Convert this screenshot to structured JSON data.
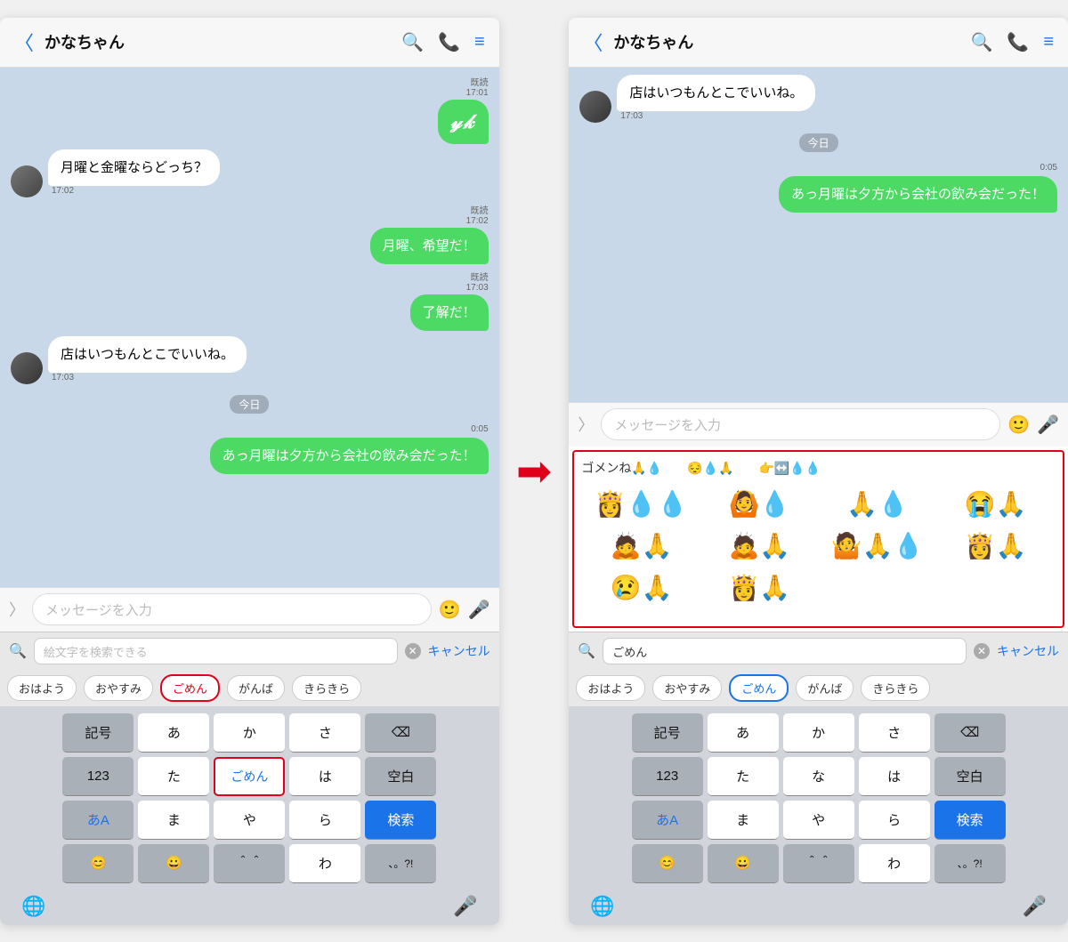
{
  "left_phone": {
    "header": {
      "back_label": "＜",
      "title": "かなちゃん",
      "search_icon": "🔍",
      "phone_icon": "📞",
      "menu_icon": "≡"
    },
    "messages": [
      {
        "id": 1,
        "side": "right",
        "text": "",
        "time": "17:01",
        "read": "既読",
        "is_handwriting": true
      },
      {
        "id": 2,
        "side": "left",
        "text": "月曜と金曜ならどっち？",
        "time": "17:02"
      },
      {
        "id": 3,
        "side": "right",
        "text": "月曜、希望だ！",
        "time": "17:02",
        "read": "既読"
      },
      {
        "id": 4,
        "side": "right",
        "text": "了解だ！",
        "time": "17:03",
        "read": "既読"
      },
      {
        "id": 5,
        "side": "left",
        "avatar": true,
        "text": "店はいつもんとこでいいね。",
        "time": "17:03"
      },
      {
        "id": 6,
        "date": "今日"
      },
      {
        "id": 7,
        "side": "right",
        "text": "あっ月曜は夕方から会社の飲み会だった！",
        "time": "0:05"
      }
    ],
    "input_placeholder": "メッセージを入力",
    "search_area": {
      "placeholder": "絵文字を検索できる",
      "cancel_label": "キャンセル"
    },
    "emoji_cats": [
      "おはよう",
      "おやすみ",
      "ごめん",
      "がんば",
      "きらきら"
    ],
    "active_cat": "ごめん",
    "keyboard": {
      "row1": [
        "記号",
        "あ",
        "か",
        "さ",
        "⌫"
      ],
      "row2": [
        "123",
        "た",
        "ごめん",
        "は",
        "空白"
      ],
      "row3": [
        "あA",
        "ま",
        "や",
        "ら",
        "検索"
      ],
      "row4": [
        "🌐",
        "😊",
        "＾＾",
        "わ",
        "、。?!"
      ],
      "bottom": [
        "🌐",
        "🎤"
      ]
    },
    "highlight_key": "ごめん",
    "highlight_cat": "ごめん"
  },
  "right_phone": {
    "header": {
      "back_label": "＜",
      "title": "かなちゃん",
      "search_icon": "🔍",
      "phone_icon": "📞",
      "menu_icon": "≡"
    },
    "messages": [
      {
        "id": 1,
        "side": "left",
        "avatar": true,
        "text": "店はいつもんとこでいいね。",
        "time": "17:03"
      },
      {
        "id": 2,
        "date": "今日"
      },
      {
        "id": 3,
        "side": "right",
        "text": "あっ月曜は夕方から会社の飲み会だった！",
        "time": "0:05"
      }
    ],
    "input_placeholder": "メッセージを入力",
    "search_area": {
      "value": "ごめん",
      "cancel_label": "キャンセル"
    },
    "emoji_cats": [
      "おはよう",
      "おやすみ",
      "ごめん",
      "がんば",
      "きらきら"
    ],
    "active_cat": "ごめん",
    "emoji_results_header": "ゴメンね🙏💧",
    "emoji_results": [
      "😔💧🙏",
      "👉↔️💧💧",
      "👸💧💧",
      "🙆💧",
      "🙏💧",
      "😭🙏",
      "🙇🙏",
      "🙇🙏",
      "🤷🙏💧",
      "👸🙏",
      "😢🙏",
      "👸🙏"
    ],
    "keyboard": {
      "row1": [
        "記号",
        "あ",
        "か",
        "さ",
        "⌫"
      ],
      "row2": [
        "123",
        "た",
        "な",
        "は",
        "空白"
      ],
      "row3": [
        "あA",
        "ま",
        "や",
        "ら",
        "検索"
      ],
      "row4": [
        "🌐",
        "😊",
        "＾＾",
        "わ",
        "、。?!"
      ],
      "bottom": [
        "🌐",
        "🎤"
      ]
    }
  },
  "arrow": "→"
}
